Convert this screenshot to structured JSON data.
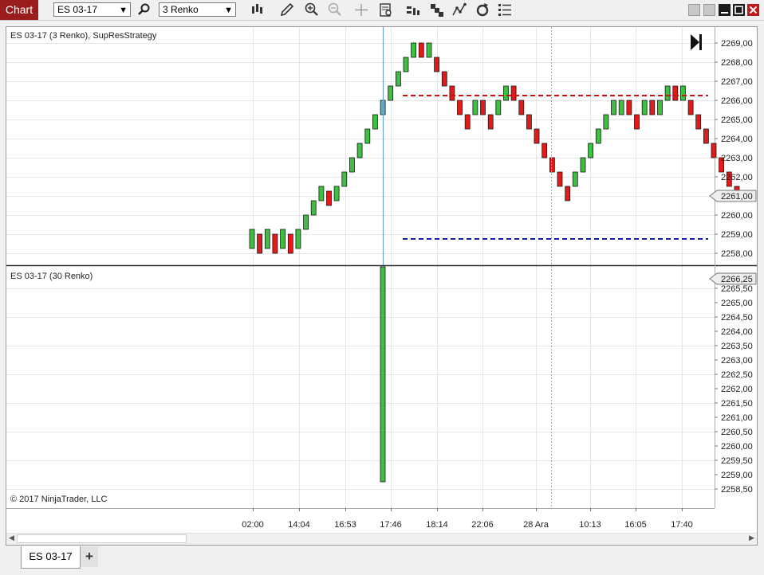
{
  "toolbar": {
    "chart_label": "Chart",
    "instrument": "ES 03-17",
    "bar_type": "3 Renko",
    "icons": [
      "search-icon",
      "bar-type-icon",
      "draw-tool-icon",
      "zoom-in-icon",
      "zoom-out-icon",
      "crosshair-icon",
      "data-box-icon",
      "properties-icon",
      "strategies-icon",
      "indicators-icon",
      "reload-icon",
      "chart-trader-icon"
    ]
  },
  "colors": {
    "up": "#3fbf3f",
    "down": "#e31a1a",
    "title_bar": "#9b1c1c",
    "resistance": "#d01010",
    "support": "#1020b0",
    "cursor_line": "#6aa0d8"
  },
  "top_panel": {
    "label": "ES 03-17 (3 Renko), SupResStrategy",
    "price_ticks": [
      "2269,00",
      "2268,00",
      "2267,00",
      "2266,00",
      "2265,00",
      "2264,00",
      "2263,00",
      "2262,00",
      "2261,00",
      "2260,00",
      "2259,00",
      "2258,00"
    ],
    "current_price": "2261,00",
    "resistance_level": 2266.25,
    "support_level": 2258.75,
    "bars": [
      {
        "o": 2258.25,
        "c": 2259.25
      },
      {
        "o": 2259.0,
        "c": 2258.0
      },
      {
        "o": 2258.25,
        "c": 2259.25
      },
      {
        "o": 2259.0,
        "c": 2258.0
      },
      {
        "o": 2258.25,
        "c": 2259.25
      },
      {
        "o": 2259.0,
        "c": 2258.0
      },
      {
        "o": 2258.25,
        "c": 2259.25
      },
      {
        "o": 2259.25,
        "c": 2260.0
      },
      {
        "o": 2260.0,
        "c": 2260.75
      },
      {
        "o": 2260.75,
        "c": 2261.5
      },
      {
        "o": 2261.25,
        "c": 2260.5
      },
      {
        "o": 2260.75,
        "c": 2261.5
      },
      {
        "o": 2261.5,
        "c": 2262.25
      },
      {
        "o": 2262.25,
        "c": 2263.0
      },
      {
        "o": 2263.0,
        "c": 2263.75
      },
      {
        "o": 2263.75,
        "c": 2264.5
      },
      {
        "o": 2264.5,
        "c": 2265.25
      },
      {
        "o": 2265.25,
        "c": 2266.0
      },
      {
        "o": 2266.0,
        "c": 2266.75
      },
      {
        "o": 2266.75,
        "c": 2267.5
      },
      {
        "o": 2267.5,
        "c": 2268.25
      },
      {
        "o": 2268.25,
        "c": 2269.0
      },
      {
        "o": 2269.0,
        "c": 2268.25
      },
      {
        "o": 2268.25,
        "c": 2269.0
      },
      {
        "o": 2268.25,
        "c": 2267.5
      },
      {
        "o": 2267.5,
        "c": 2266.75
      },
      {
        "o": 2266.75,
        "c": 2266.0
      },
      {
        "o": 2266.0,
        "c": 2265.25
      },
      {
        "o": 2265.25,
        "c": 2264.5
      },
      {
        "o": 2265.25,
        "c": 2266.0
      },
      {
        "o": 2266.0,
        "c": 2265.25
      },
      {
        "o": 2265.25,
        "c": 2264.5
      },
      {
        "o": 2265.25,
        "c": 2266.0
      },
      {
        "o": 2266.0,
        "c": 2266.75
      },
      {
        "o": 2266.75,
        "c": 2266.0
      },
      {
        "o": 2266.0,
        "c": 2265.25
      },
      {
        "o": 2265.25,
        "c": 2264.5
      },
      {
        "o": 2264.5,
        "c": 2263.75
      },
      {
        "o": 2263.75,
        "c": 2263.0
      },
      {
        "o": 2263.0,
        "c": 2262.25
      },
      {
        "o": 2262.25,
        "c": 2261.5
      },
      {
        "o": 2261.5,
        "c": 2260.75
      },
      {
        "o": 2261.5,
        "c": 2262.25
      },
      {
        "o": 2262.25,
        "c": 2263.0
      },
      {
        "o": 2263.0,
        "c": 2263.75
      },
      {
        "o": 2263.75,
        "c": 2264.5
      },
      {
        "o": 2264.5,
        "c": 2265.25
      },
      {
        "o": 2265.25,
        "c": 2266.0
      },
      {
        "o": 2265.25,
        "c": 2266.0
      },
      {
        "o": 2266.0,
        "c": 2265.25
      },
      {
        "o": 2265.25,
        "c": 2264.5
      },
      {
        "o": 2265.25,
        "c": 2266.0
      },
      {
        "o": 2266.0,
        "c": 2265.25
      },
      {
        "o": 2265.25,
        "c": 2266.0
      },
      {
        "o": 2266.0,
        "c": 2266.75
      },
      {
        "o": 2266.75,
        "c": 2266.0
      },
      {
        "o": 2266.0,
        "c": 2266.75
      },
      {
        "o": 2266.0,
        "c": 2265.25
      },
      {
        "o": 2265.25,
        "c": 2264.5
      },
      {
        "o": 2264.5,
        "c": 2263.75
      },
      {
        "o": 2263.75,
        "c": 2263.0
      },
      {
        "o": 2263.0,
        "c": 2262.25
      },
      {
        "o": 2262.25,
        "c": 2261.5
      },
      {
        "o": 2261.5,
        "c": 2260.75
      }
    ]
  },
  "bottom_panel": {
    "label": "ES 03-17 (30 Renko)",
    "price_ticks": [
      "2265,50",
      "2265,00",
      "2264,50",
      "2264,00",
      "2263,50",
      "2263,00",
      "2262,50",
      "2262,00",
      "2261,50",
      "2261,00",
      "2260,50",
      "2260,00",
      "2259,50",
      "2259,00",
      "2258,50"
    ],
    "current_price": "2266,25",
    "bar": {
      "o": 2258.75,
      "c": 2266.25
    },
    "copyright": "© 2017 NinjaTrader, LLC"
  },
  "time_axis": [
    "02:00",
    "14:04",
    "16:53",
    "17:46",
    "18:14",
    "22:06",
    "28 Ara",
    "10:13",
    "16:05",
    "17:40"
  ],
  "tabs": {
    "active": "ES 03-17",
    "add": "+"
  }
}
